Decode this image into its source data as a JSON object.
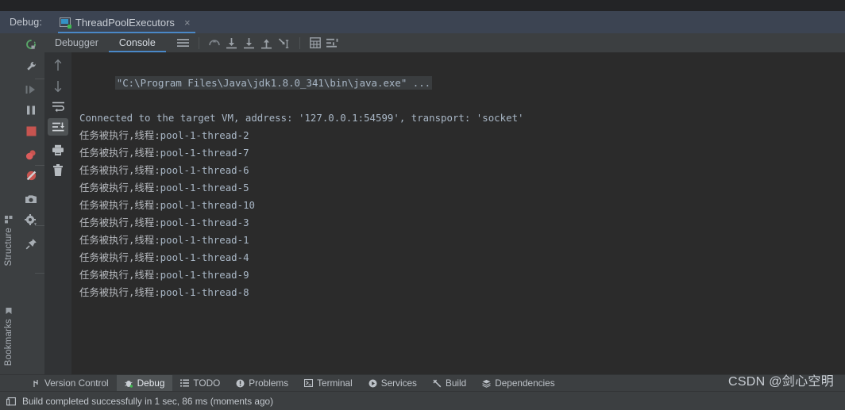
{
  "window": {
    "debug_label": "Debug:",
    "run_tab": {
      "title": "ThreadPoolExecutors",
      "close": "×",
      "icon": "run-configuration-icon"
    }
  },
  "left_rail": {
    "items": [
      {
        "label": "Structure",
        "icon": "structure-icon"
      },
      {
        "label": "Bookmarks",
        "icon": "bookmark-icon"
      }
    ]
  },
  "debug_toolbar": {
    "items": [
      {
        "name": "rerun-button",
        "icon": "rerun-icon"
      },
      {
        "name": "modify-run-configuration-button",
        "icon": "wrench-icon"
      },
      {
        "name": "resume-program-button",
        "icon": "resume-icon"
      },
      {
        "name": "pause-program-button",
        "icon": "pause-icon"
      },
      {
        "name": "stop-button",
        "icon": "stop-icon"
      },
      {
        "name": "view-breakpoints-button",
        "icon": "breakpoints-icon"
      },
      {
        "name": "mute-breakpoints-button",
        "icon": "mute-breakpoints-icon"
      },
      {
        "name": "screenshot-button",
        "icon": "camera-icon"
      },
      {
        "name": "settings-button",
        "icon": "gear-icon"
      },
      {
        "name": "pin-tab-button",
        "icon": "pin-icon"
      }
    ]
  },
  "console_toolbar": {
    "items": [
      {
        "name": "up-button",
        "icon": "arrow-up-icon"
      },
      {
        "name": "down-button",
        "icon": "arrow-down-icon"
      },
      {
        "name": "soft-wrap-button",
        "icon": "soft-wrap-icon"
      },
      {
        "name": "scroll-to-end-button",
        "icon": "scroll-to-end-icon",
        "selected": true
      },
      {
        "name": "print-button",
        "icon": "print-icon"
      },
      {
        "name": "clear-all-button",
        "icon": "trash-icon"
      }
    ]
  },
  "panel_tabs": {
    "tabs": [
      {
        "label": "Debugger",
        "active": false
      },
      {
        "label": "Console",
        "active": true
      }
    ],
    "tool_icons": [
      {
        "name": "menu-button",
        "icon": "hamburger-icon"
      },
      {
        "name": "step-out-button",
        "icon": "step-out-arc-icon"
      },
      {
        "name": "step-over-button",
        "icon": "step-over-icon"
      },
      {
        "name": "step-into-button",
        "icon": "step-into-icon"
      },
      {
        "name": "force-step-into-button",
        "icon": "force-step-into-icon"
      },
      {
        "name": "run-to-cursor-button",
        "icon": "run-to-cursor-icon"
      },
      {
        "name": "evaluate-expression-button",
        "icon": "calculator-icon"
      },
      {
        "name": "layout-settings-button",
        "icon": "layout-icon"
      }
    ]
  },
  "console": {
    "lines": [
      {
        "type": "command",
        "text": "\"C:\\Program Files\\Java\\jdk1.8.0_341\\bin\\java.exe\" ..."
      },
      {
        "type": "info",
        "text": "Connected to the target VM, address: '127.0.0.1:54599', transport: 'socket'"
      },
      {
        "type": "output",
        "prefix": "任务被执行,线程:",
        "thread": "pool-1-thread-2"
      },
      {
        "type": "output",
        "prefix": "任务被执行,线程:",
        "thread": "pool-1-thread-7"
      },
      {
        "type": "output",
        "prefix": "任务被执行,线程:",
        "thread": "pool-1-thread-6"
      },
      {
        "type": "output",
        "prefix": "任务被执行,线程:",
        "thread": "pool-1-thread-5"
      },
      {
        "type": "output",
        "prefix": "任务被执行,线程:",
        "thread": "pool-1-thread-10"
      },
      {
        "type": "output",
        "prefix": "任务被执行,线程:",
        "thread": "pool-1-thread-3"
      },
      {
        "type": "output",
        "prefix": "任务被执行,线程:",
        "thread": "pool-1-thread-1"
      },
      {
        "type": "output",
        "prefix": "任务被执行,线程:",
        "thread": "pool-1-thread-4"
      },
      {
        "type": "output",
        "prefix": "任务被执行,线程:",
        "thread": "pool-1-thread-9"
      },
      {
        "type": "output",
        "prefix": "任务被执行,线程:",
        "thread": "pool-1-thread-8"
      }
    ]
  },
  "tool_window_bar": {
    "tabs": [
      {
        "label": "Version Control",
        "icon": "branch-icon",
        "active": false
      },
      {
        "label": "Debug",
        "icon": "bug-icon",
        "active": true
      },
      {
        "label": "TODO",
        "icon": "list-icon",
        "active": false
      },
      {
        "label": "Problems",
        "icon": "warning-icon",
        "active": false
      },
      {
        "label": "Terminal",
        "icon": "terminal-icon",
        "active": false
      },
      {
        "label": "Services",
        "icon": "play-circle-icon",
        "active": false
      },
      {
        "label": "Build",
        "icon": "hammer-icon",
        "active": false
      },
      {
        "label": "Dependencies",
        "icon": "layers-icon",
        "active": false
      }
    ]
  },
  "status_bar": {
    "icon": "build-icon",
    "message": "Build completed successfully in 1 sec, 86 ms (moments ago)"
  },
  "watermark": {
    "text": "CSDN @剑心空明"
  },
  "colors": {
    "accent_blue": "#4a88c7",
    "header_bar": "#3c4452",
    "panel": "#3c3f41",
    "console_bg": "#2b2b2b",
    "text": "#a9b7c6",
    "stop_red": "#c75450",
    "green": "#3fb950"
  }
}
